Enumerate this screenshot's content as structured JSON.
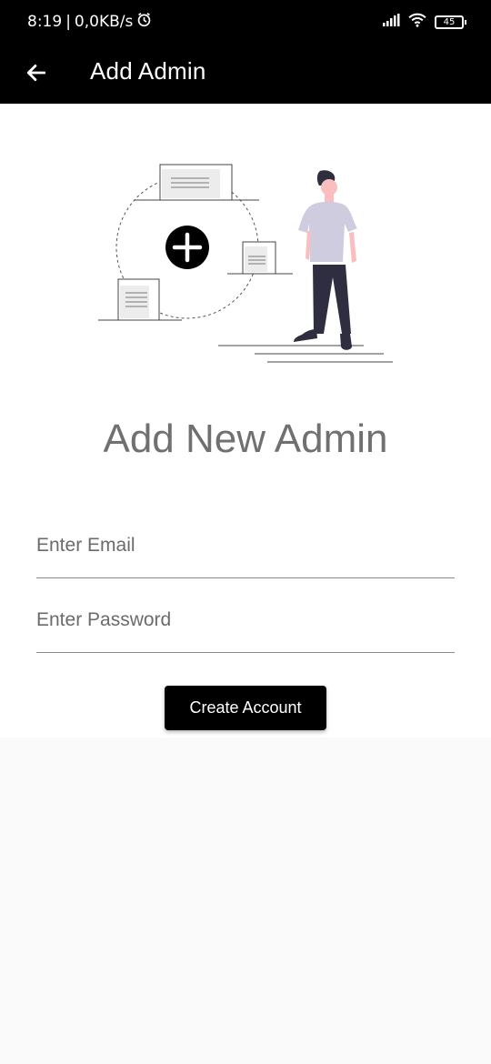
{
  "status_bar": {
    "time": "8:19",
    "network_speed": "0,0KB/s",
    "battery": "45",
    "icons": [
      "alarm-icon",
      "signal-icon",
      "wifi-icon",
      "battery-icon"
    ]
  },
  "app_bar": {
    "title": "Add Admin",
    "back_icon": "arrow-left-icon"
  },
  "main": {
    "heading": "Add New Admin",
    "email_placeholder": "Enter Email",
    "password_placeholder": "Enter Password",
    "create_button_label": "Create Account"
  },
  "colors": {
    "app_bar": "#000000",
    "heading": "#707070",
    "person_shirt": "#cfcce0",
    "person_pants": "#2f2e41"
  }
}
